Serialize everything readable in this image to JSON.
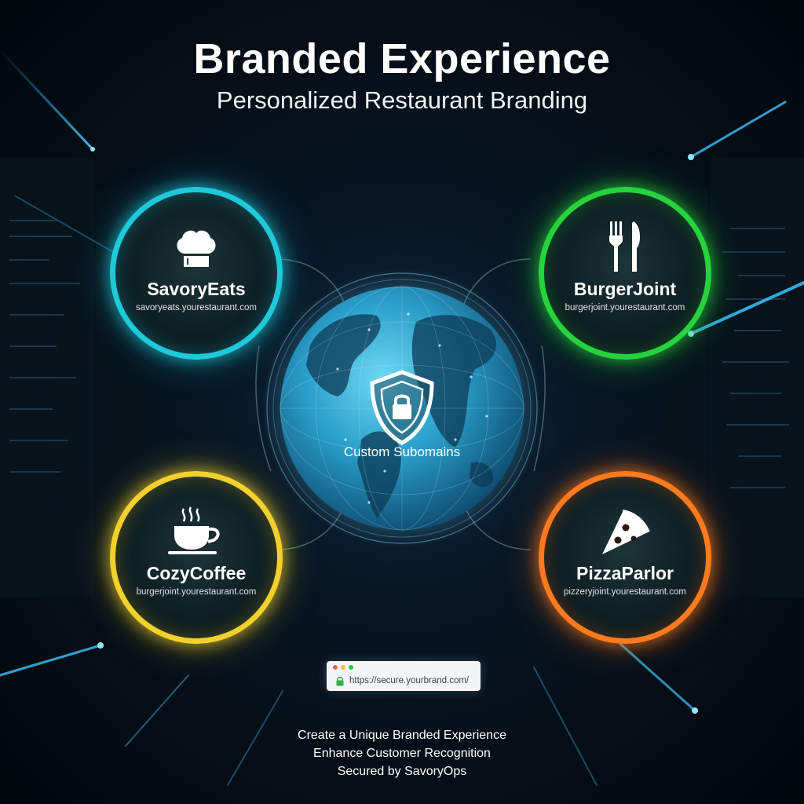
{
  "header": {
    "title": "Branded Experience",
    "subtitle": "Personalized Restaurant Branding"
  },
  "center": {
    "label": "Custom Subomains",
    "icon": "shield-lock-icon"
  },
  "restaurants": [
    {
      "name": "SavoryEats",
      "domain": "savoryeats.yourestaurant.com",
      "icon": "chef-hat-icon",
      "color": "#1fc9d9"
    },
    {
      "name": "BurgerJoint",
      "domain": "burgerjoint.yourestaurant.com",
      "icon": "fork-knife-icon",
      "color": "#27d33d"
    },
    {
      "name": "CozyCoffee",
      "domain": "burgerjoint.yourestaurant.com",
      "icon": "coffee-cup-icon",
      "color": "#f2d12c"
    },
    {
      "name": "PizzaParlor",
      "domain": "pizzeryjoint.yourestaurant.com",
      "icon": "pizza-slice-icon",
      "color": "#ff7a1f"
    }
  ],
  "browser": {
    "url": "https://secure.yourbrand.com/",
    "dot_colors": [
      "#ff5f57",
      "#febc2e",
      "#28c840"
    ]
  },
  "footer": {
    "lines": [
      "Create a Unique Branded Experience",
      "Enhance Customer Recognition",
      "Secured by SavoryOps"
    ]
  }
}
